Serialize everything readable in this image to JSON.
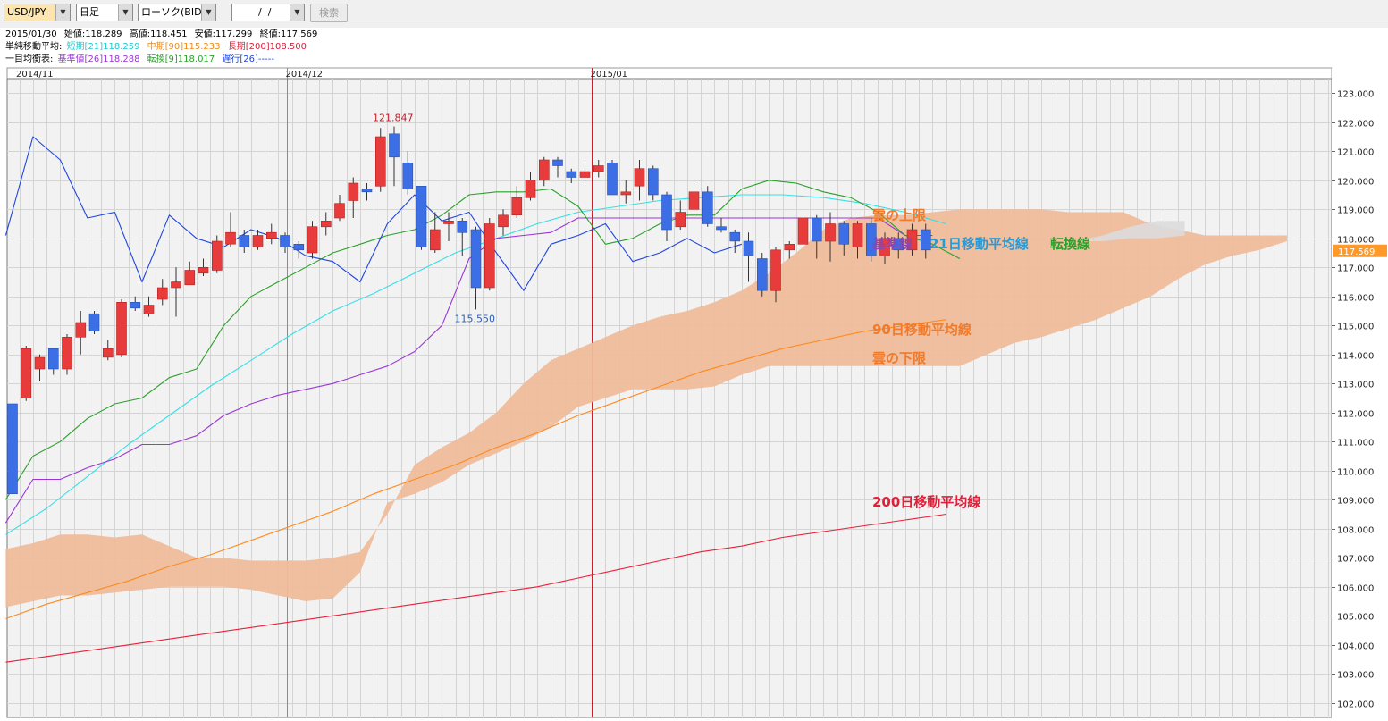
{
  "toolbar": {
    "currency": "USD/JPY",
    "timeframe": "日足",
    "chart_kind": "ローソク(BID)",
    "date_input": "  /  /",
    "search_label": "検索"
  },
  "info": {
    "date": "2015/01/30",
    "open_label": "始値:118.289",
    "high_label": "高値:118.451",
    "low_label": "安値:117.299",
    "close_label": "終値:117.569",
    "sma_label": "単純移動平均:",
    "sma_short": "短期[21]118.259",
    "sma_mid": "中期[90]115.233",
    "sma_long": "長期[200]108.500",
    "ichi_label": "一目均衡表:",
    "ichi_base": "基準値[26]118.288",
    "ichi_conv": "転換[9]118.017",
    "ichi_lag": "遅行[26]-----"
  },
  "colors": {
    "bg_plot": "#f2f2f2",
    "grid": "#d4d4d4",
    "up": "#e83c3c",
    "down": "#3c6ee6",
    "cloud": "#eebc9b",
    "future_cloud": "#dcdcdc",
    "sma21": "#35e0e6",
    "sma90": "#ff8a1e",
    "sma200": "#e8213a",
    "base": "#9a36d6",
    "conv": "#2aa02a",
    "lag": "#2046e0",
    "vline": "#c8202a",
    "price_tag": "#ff9a2a"
  },
  "chart_data": {
    "type": "candlestick",
    "title": "",
    "ylim": [
      101.5,
      123.5
    ],
    "y_ticks": [
      "102.000",
      "103.000",
      "104.000",
      "105.000",
      "106.000",
      "107.000",
      "108.000",
      "109.000",
      "110.000",
      "111.000",
      "112.000",
      "113.000",
      "114.000",
      "115.000",
      "116.000",
      "117.000",
      "118.000",
      "119.000",
      "120.000",
      "121.000",
      "122.000",
      "123.000"
    ],
    "x_labels": [
      {
        "text": "2014/11",
        "idx": 0
      },
      {
        "text": "2014/12",
        "idx": 20.6
      },
      {
        "text": "2015/01",
        "idx": 43
      }
    ],
    "current_price": "117.569",
    "high_label": "121.847",
    "low_label": "115.550",
    "candles": [
      [
        112.3,
        109.2,
        112.3,
        109.2
      ],
      [
        112.5,
        114.2,
        114.3,
        112.4
      ],
      [
        113.5,
        113.9,
        114.0,
        113.1
      ],
      [
        114.2,
        113.5,
        114.2,
        113.3
      ],
      [
        113.5,
        114.6,
        114.7,
        113.3
      ],
      [
        114.6,
        115.1,
        115.5,
        114.0
      ],
      [
        115.4,
        114.8,
        115.5,
        114.7
      ],
      [
        113.9,
        114.2,
        114.5,
        113.8
      ],
      [
        114.0,
        115.8,
        115.9,
        113.9
      ],
      [
        115.8,
        115.6,
        116.0,
        115.5
      ],
      [
        115.4,
        115.7,
        116.0,
        115.3
      ],
      [
        115.9,
        116.3,
        116.6,
        115.7
      ],
      [
        116.3,
        116.5,
        117.0,
        115.3
      ],
      [
        116.4,
        116.9,
        117.2,
        116.4
      ],
      [
        116.8,
        117.0,
        117.3,
        116.7
      ],
      [
        116.9,
        117.9,
        118.1,
        116.8
      ],
      [
        117.8,
        118.2,
        118.9,
        117.7
      ],
      [
        118.1,
        117.7,
        118.3,
        117.5
      ],
      [
        117.7,
        118.1,
        118.3,
        117.6
      ],
      [
        118.0,
        118.2,
        118.5,
        117.8
      ],
      [
        118.1,
        117.7,
        118.2,
        117.5
      ],
      [
        117.8,
        117.6,
        117.9,
        117.3
      ],
      [
        117.5,
        118.4,
        118.6,
        117.3
      ],
      [
        118.4,
        118.6,
        118.9,
        118.1
      ],
      [
        118.7,
        119.2,
        119.5,
        118.6
      ],
      [
        119.3,
        119.9,
        120.1,
        118.7
      ],
      [
        119.7,
        119.6,
        119.9,
        119.3
      ],
      [
        119.8,
        121.5,
        121.8,
        119.6
      ],
      [
        121.6,
        120.8,
        121.85,
        119.8
      ],
      [
        120.6,
        119.7,
        121.0,
        119.5
      ],
      [
        119.8,
        117.7,
        119.8,
        117.6
      ],
      [
        117.6,
        118.3,
        118.9,
        117.5
      ],
      [
        118.5,
        118.6,
        118.9,
        117.9
      ],
      [
        118.6,
        118.2,
        118.7,
        117.4
      ],
      [
        118.3,
        116.3,
        118.4,
        115.55
      ],
      [
        116.3,
        118.5,
        118.7,
        116.2
      ],
      [
        118.4,
        118.8,
        119.0,
        118.1
      ],
      [
        118.8,
        119.4,
        119.8,
        118.7
      ],
      [
        119.4,
        120.0,
        120.3,
        119.3
      ],
      [
        120.0,
        120.7,
        120.8,
        119.8
      ],
      [
        120.7,
        120.5,
        120.8,
        120.1
      ],
      [
        120.3,
        120.1,
        120.4,
        119.9
      ],
      [
        120.1,
        120.3,
        120.6,
        119.9
      ],
      [
        120.3,
        120.5,
        120.7,
        120.1
      ],
      [
        120.6,
        119.5,
        120.7,
        119.5
      ],
      [
        119.5,
        119.6,
        120.0,
        119.2
      ],
      [
        119.8,
        120.4,
        120.7,
        119.3
      ],
      [
        120.4,
        119.5,
        120.5,
        119.3
      ],
      [
        119.5,
        118.3,
        119.6,
        117.9
      ],
      [
        118.4,
        118.9,
        119.3,
        118.3
      ],
      [
        119.0,
        119.6,
        119.9,
        118.8
      ],
      [
        119.6,
        118.5,
        119.8,
        118.4
      ],
      [
        118.4,
        118.3,
        118.7,
        118.2
      ],
      [
        118.2,
        117.9,
        118.3,
        117.5
      ],
      [
        117.9,
        117.4,
        118.2,
        116.5
      ],
      [
        117.3,
        116.2,
        117.5,
        116.0
      ],
      [
        116.2,
        117.6,
        117.7,
        115.8
      ],
      [
        117.6,
        117.8,
        117.9,
        117.3
      ],
      [
        117.8,
        118.7,
        118.8,
        117.8
      ],
      [
        118.7,
        117.9,
        118.8,
        117.3
      ],
      [
        117.9,
        118.5,
        118.9,
        117.2
      ],
      [
        118.5,
        117.8,
        118.6,
        117.4
      ],
      [
        117.7,
        118.5,
        118.6,
        117.3
      ],
      [
        118.5,
        117.4,
        118.7,
        117.2
      ],
      [
        117.4,
        118.0,
        118.2,
        117.1
      ],
      [
        118.0,
        117.6,
        118.2,
        117.3
      ],
      [
        117.6,
        118.3,
        118.5,
        117.4
      ],
      [
        118.3,
        117.6,
        118.5,
        117.3
      ]
    ],
    "sma21": {
      "x0": -0.5,
      "step": 3,
      "values": [
        107.8,
        108.7,
        109.8,
        110.9,
        111.9,
        112.9,
        113.8,
        114.7,
        115.5,
        116.1,
        116.8,
        117.5,
        118.0,
        118.5,
        118.9,
        119.1,
        119.3,
        119.4,
        119.5,
        119.5,
        119.4,
        119.2,
        118.9,
        118.5
      ]
    },
    "sma90": {
      "x0": -0.5,
      "step": 3,
      "values": [
        104.9,
        105.4,
        105.8,
        106.2,
        106.7,
        107.1,
        107.6,
        108.1,
        108.6,
        109.2,
        109.7,
        110.2,
        110.8,
        111.3,
        111.9,
        112.4,
        112.9,
        113.4,
        113.8,
        114.2,
        114.5,
        114.8,
        115.0,
        115.2
      ]
    },
    "sma200": {
      "x0": -0.5,
      "step": 3,
      "values": [
        103.4,
        103.6,
        103.8,
        104.0,
        104.2,
        104.4,
        104.6,
        104.8,
        105.0,
        105.2,
        105.4,
        105.6,
        105.8,
        106.0,
        106.3,
        106.6,
        106.9,
        107.2,
        107.4,
        107.7,
        107.9,
        108.1,
        108.3,
        108.5
      ]
    },
    "base": {
      "x0": -0.5,
      "step": 2,
      "values": [
        108.2,
        109.7,
        109.7,
        110.1,
        110.4,
        110.9,
        110.9,
        111.2,
        111.9,
        112.3,
        112.6,
        112.8,
        113.0,
        113.3,
        113.6,
        114.1,
        115.0,
        117.3,
        118.0,
        118.1,
        118.2,
        118.7,
        118.7,
        118.7,
        118.7,
        118.7,
        118.7,
        118.7,
        118.7,
        118.7,
        118.7,
        118.7,
        118.7,
        118.1,
        118.1
      ]
    },
    "conv": {
      "x0": -0.5,
      "step": 2,
      "values": [
        109.0,
        110.5,
        111.0,
        111.8,
        112.3,
        112.5,
        113.2,
        113.5,
        115.0,
        116.0,
        116.5,
        117.0,
        117.5,
        117.8,
        118.1,
        118.3,
        118.8,
        119.5,
        119.6,
        119.6,
        119.7,
        119.1,
        117.8,
        118.0,
        118.5,
        118.8,
        118.8,
        119.7,
        120.0,
        119.9,
        119.6,
        119.4,
        118.9,
        118.1,
        117.8,
        117.3
      ]
    },
    "lag": {
      "x0": -0.5,
      "step": 2,
      "values": [
        118.1,
        121.5,
        120.7,
        118.7,
        118.9,
        116.5,
        118.8,
        118.0,
        117.7,
        118.3,
        118.0,
        117.4,
        117.2,
        116.5,
        118.5,
        119.5,
        118.6,
        118.9,
        117.5,
        116.2,
        117.8,
        118.1,
        118.5,
        117.2,
        117.5,
        118.0,
        117.5,
        117.8
      ]
    },
    "cloud": {
      "x0": -0.5,
      "step": 2,
      "upper": [
        107.3,
        107.5,
        107.8,
        107.8,
        107.7,
        107.8,
        107.4,
        107.0,
        107.0,
        106.9,
        106.9,
        106.9,
        107.0,
        107.2,
        108.5,
        110.2,
        110.8,
        111.3,
        112.0,
        113.0,
        113.8,
        114.2,
        114.6,
        115.0,
        115.3,
        115.5,
        115.8,
        116.2,
        116.8,
        117.5,
        118.3,
        118.7,
        118.8,
        118.8,
        118.9,
        119.0,
        119.0,
        119.0,
        119.0,
        118.9,
        118.9,
        118.9,
        118.5,
        118.3,
        118.1,
        118.1,
        118.1,
        118.1
      ],
      "lower": [
        105.3,
        105.5,
        105.7,
        105.7,
        105.8,
        105.9,
        106.0,
        106.0,
        106.0,
        105.9,
        105.7,
        105.5,
        105.6,
        106.5,
        108.9,
        109.2,
        109.6,
        110.2,
        110.6,
        111.0,
        111.5,
        112.2,
        112.5,
        112.8,
        112.8,
        112.8,
        112.9,
        113.3,
        113.6,
        113.6,
        113.6,
        113.6,
        113.6,
        113.6,
        113.6,
        113.6,
        114.0,
        114.4,
        114.6,
        114.9,
        115.2,
        115.6,
        116.0,
        116.6,
        117.1,
        117.4,
        117.6,
        117.9
      ]
    },
    "future_cloud": {
      "x0": 78,
      "step": 2,
      "upper": [
        117.9,
        118.1,
        118.4,
        118.6,
        118.6
      ],
      "lower": [
        117.9,
        117.9,
        118.0,
        118.0,
        118.1
      ]
    },
    "annotations": {
      "cloud_upper": "雲の上限",
      "base_line": "基準線",
      "sma21_line": "21日移動平均線",
      "conv_line": "転換線",
      "sma90_line": "90日移動平均線",
      "cloud_lower": "雲の下限",
      "sma200_line": "200日移動平均線"
    }
  }
}
